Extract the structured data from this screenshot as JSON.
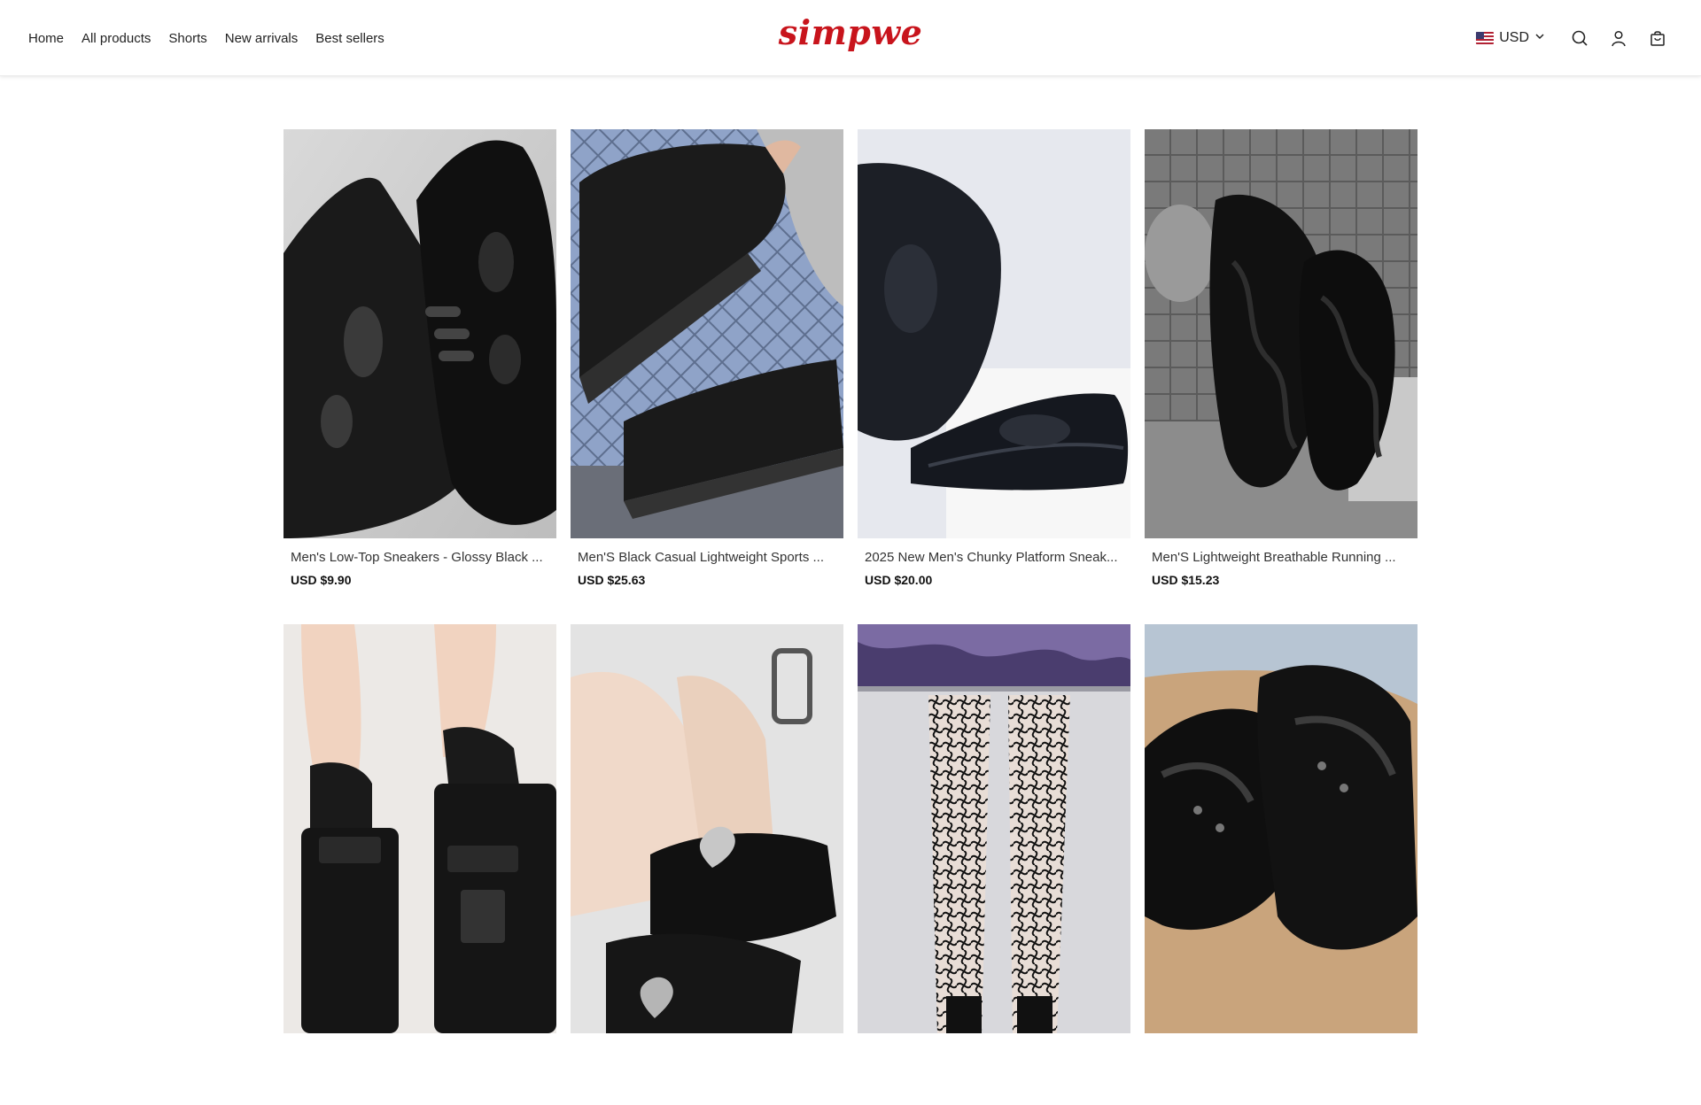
{
  "nav": {
    "items": [
      "Home",
      "All products",
      "Shorts",
      "New arrivals",
      "Best sellers"
    ]
  },
  "brand": {
    "logo_text": "simpwe",
    "color": "#c8141c"
  },
  "tools": {
    "currency": "USD",
    "icons": [
      "search-icon",
      "account-icon",
      "cart-icon"
    ]
  },
  "products": [
    {
      "title": "Men's Low-Top Sneakers - Glossy Black ...",
      "price": "USD $9.90"
    },
    {
      "title": "Men'S Black Casual Lightweight Sports ...",
      "price": "USD $25.63"
    },
    {
      "title": "2025 New Men's Chunky Platform Sneak...",
      "price": "USD $20.00"
    },
    {
      "title": "Men'S Lightweight Breathable Running ...",
      "price": "USD $15.23"
    },
    {
      "title": "",
      "price": ""
    },
    {
      "title": "",
      "price": ""
    },
    {
      "title": "",
      "price": ""
    },
    {
      "title": "",
      "price": ""
    }
  ]
}
